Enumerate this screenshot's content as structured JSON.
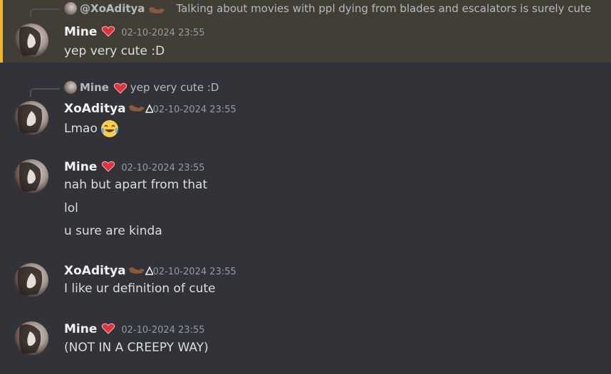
{
  "messages": [
    {
      "id": "m1",
      "highlighted": true,
      "reply": {
        "author": "@XoAditya",
        "text": "Talking about movies with ppl dying from blades and escalators is surely cute"
      },
      "author": "Mine",
      "timestamp": "02-10-2024 23:55",
      "lines": [
        "yep very cute :D"
      ]
    },
    {
      "id": "m2",
      "reply": {
        "author": "Mine",
        "text": "yep very cute :D"
      },
      "author": "XoAditya",
      "timestamp": "02-10-2024 23:55",
      "lines": [
        "Lmao"
      ],
      "emoji": "face-with-tears-of-joy"
    },
    {
      "id": "m3",
      "author": "Mine",
      "timestamp": "02-10-2024 23:55",
      "lines": [
        "nah but apart from that",
        "lol",
        "u sure are kinda"
      ]
    },
    {
      "id": "m4",
      "author": "XoAditya",
      "timestamp": "02-10-2024 23:55",
      "lines": [
        "I like ur definition of cute"
      ]
    },
    {
      "id": "m5",
      "author": "Mine",
      "timestamp": "02-10-2024 23:55",
      "lines": [
        "(NOT IN A CREEPY WAY)"
      ]
    }
  ],
  "colors": {
    "background": "#313338",
    "highlight_background": "#413e36",
    "highlight_border": "#f0b232",
    "username": "#f2f3f5",
    "message_text": "#dbdee1",
    "timestamp": "#949ba4",
    "reply_text": "#b5bac1",
    "heart": "#e0323c"
  },
  "icons": {
    "mine_badge": "heart-icon",
    "xoaditya_badge": "flexed-arm-icon"
  }
}
